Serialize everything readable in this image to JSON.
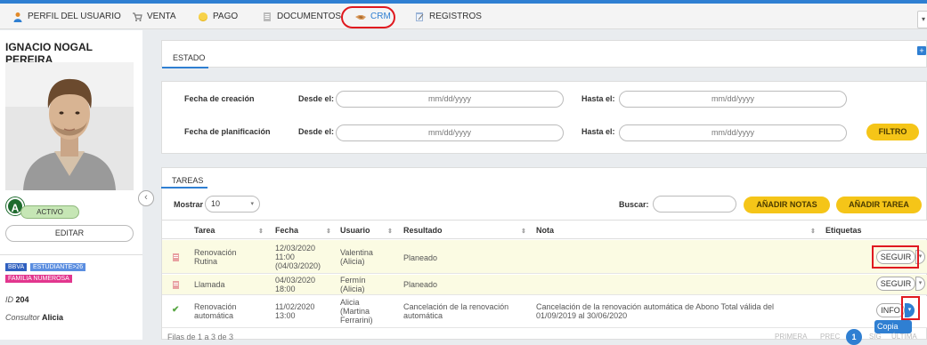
{
  "nav": {
    "items": [
      {
        "label": "PERFIL DEL USUARIO",
        "icon": "user-icon"
      },
      {
        "label": "VENTA",
        "icon": "cart-icon"
      },
      {
        "label": "PAGO",
        "icon": "coin-icon"
      },
      {
        "label": "DOCUMENTOS",
        "icon": "document-icon"
      },
      {
        "label": "CRM",
        "icon": "handshake-icon"
      },
      {
        "label": "REGISTROS",
        "icon": "notepad-icon"
      }
    ],
    "menu_label": "▾"
  },
  "profile": {
    "name": "IGNACIO NOGAL PEREIRA",
    "avatar_letter": "A",
    "status": "ACTIVO",
    "edit_label": "EDITAR",
    "collapse_label": "‹",
    "badges": [
      "BBVA",
      "ESTUDIANTE>26",
      "FAMILIA NUMEROSA"
    ],
    "id_label": "ID",
    "id_value": "204",
    "consultor_label": "Consultor",
    "consultor_value": "Alicia"
  },
  "estado": {
    "title": "ESTADO",
    "plus": "+"
  },
  "filters": {
    "creation_label": "Fecha de creación",
    "planning_label": "Fecha de planificación",
    "from_label": "Desde el:",
    "to_label": "Hasta el:",
    "date_placeholder": "mm/dd/yyyy",
    "filter_button": "FILTRO"
  },
  "tasks": {
    "title": "TAREAS",
    "show_label": "Mostrar",
    "show_value": "10",
    "search_label": "Buscar:",
    "add_notes_button": "AÑADIR NOTAS",
    "add_task_button": "AÑADIR TAREA",
    "columns": [
      "Tarea",
      "Fecha",
      "Usuario",
      "Resultado",
      "Nota",
      "Etiquetas"
    ],
    "rows": [
      {
        "tarea": "Renovación Rutina",
        "fecha": "12/03/2020 11:00 (04/03/2020)",
        "usuario": "Valentina (Alicia)",
        "resultado": "Planeado",
        "nota": "",
        "action": "SEGUIR",
        "icon": "task-icon"
      },
      {
        "tarea": "Llamada",
        "fecha": "04/03/2020 18:00",
        "usuario": "Fermín (Alicia)",
        "resultado": "Planeado",
        "nota": "",
        "action": "SEGUIR",
        "icon": "task-icon"
      },
      {
        "tarea": "Renovación automática",
        "fecha": "11/02/2020 13:00",
        "usuario": "Alicia (Martina Ferrarini)",
        "resultado": "Cancelación de la renovación automática",
        "nota": "Cancelación de la renovación automática de Abono Total válida del 01/09/2019 al 30/06/2020",
        "action": "INFO",
        "icon": "check-icon"
      }
    ],
    "dropdown_option": "Copia",
    "footer_text": "Filas de 1 a 3 de 3",
    "pagination": [
      "PRIMERA",
      "PREC",
      "1",
      "SIG",
      "ÚLTIMA"
    ]
  },
  "colors": {
    "accent": "#2f7fd2",
    "highlight_row": "#fbfbe3",
    "button_yellow": "#f5c518",
    "annotation_red": "#e0191f"
  }
}
